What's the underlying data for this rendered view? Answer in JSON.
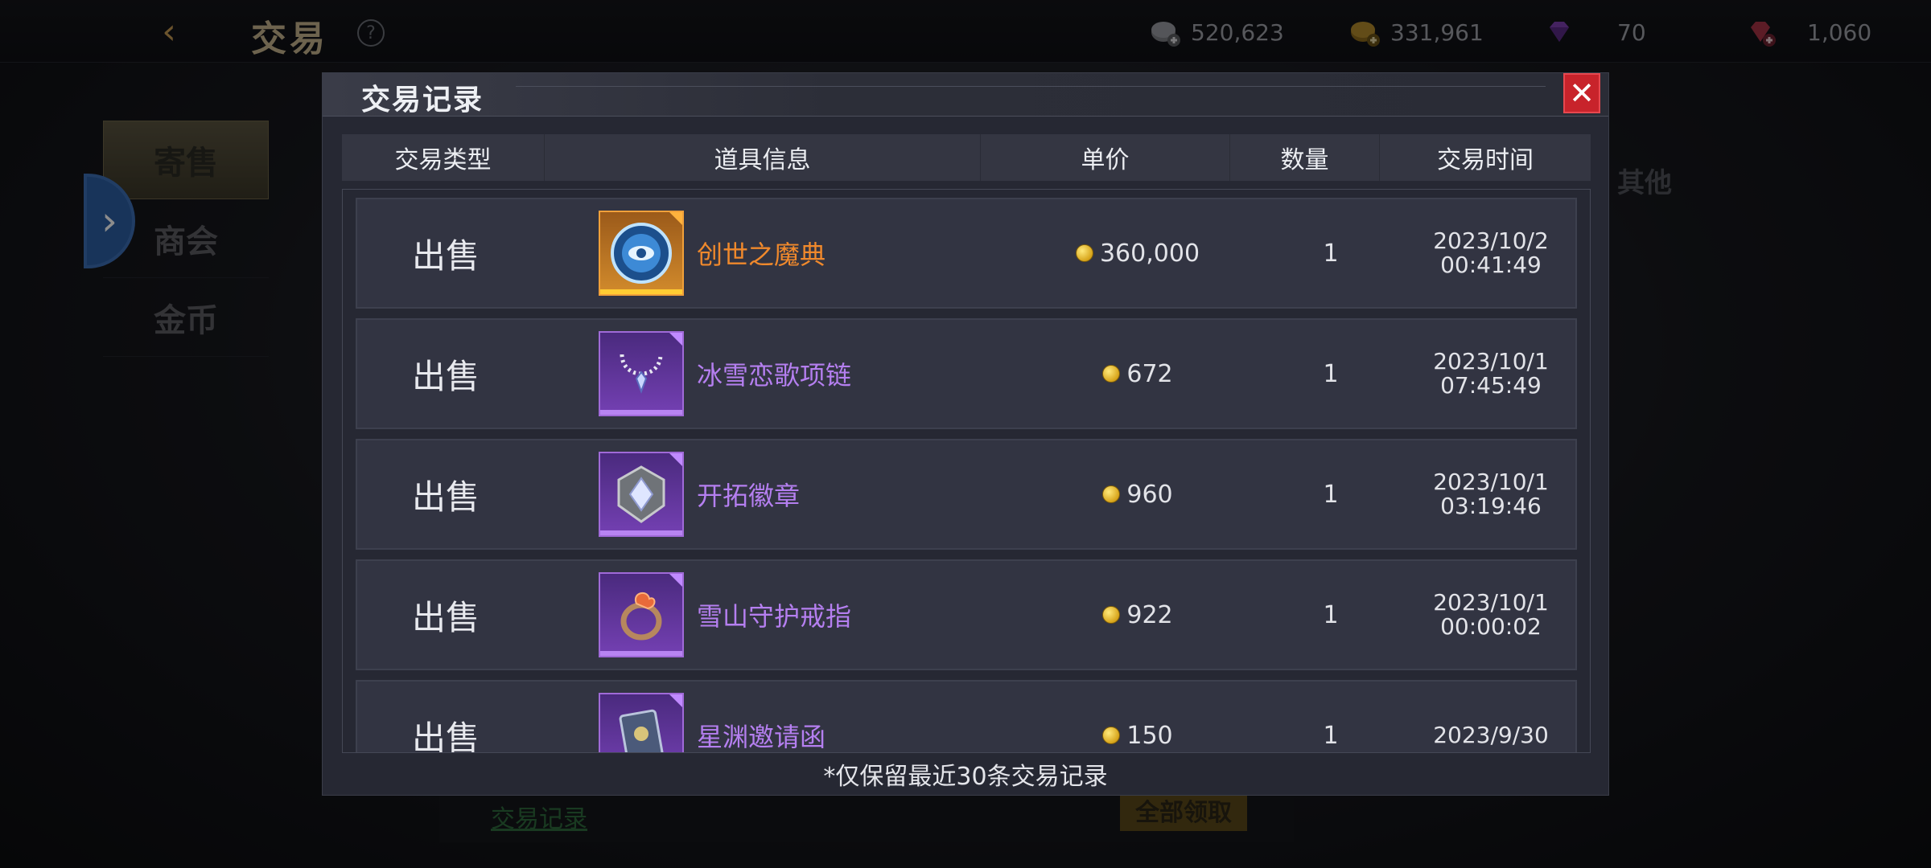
{
  "top_bar": {
    "title": "交易",
    "help": "?",
    "currencies": [
      {
        "icon": "silver-coin-add-icon",
        "value": "520,623",
        "color": "#8a8c91"
      },
      {
        "icon": "gold-coin-add-icon",
        "value": "331,961",
        "color": "#b38b2c"
      },
      {
        "icon": "purple-diamond-icon",
        "value": "70",
        "color": "#7d3fb0"
      },
      {
        "icon": "red-gem-add-icon",
        "value": "1,060",
        "color": "#a83346"
      }
    ]
  },
  "background": {
    "tabs": [
      {
        "label": "寄售",
        "active": true
      },
      {
        "label": "商会",
        "active": false
      },
      {
        "label": "金币",
        "active": false
      }
    ],
    "category_other": "其他",
    "history_link": "交易记录",
    "claim_all_button": "全部领取"
  },
  "modal": {
    "title": "交易记录",
    "close_icon": "close-icon",
    "columns": [
      "交易类型",
      "道具信息",
      "单价",
      "数量",
      "交易时间"
    ],
    "records": [
      {
        "type": "出售",
        "item_name": "创世之魔典",
        "rarity": "orange",
        "item_icon": "magic-tome-icon",
        "price": "360,000",
        "quantity": "1",
        "date": "2023/10/2",
        "time": "00:41:49"
      },
      {
        "type": "出售",
        "item_name": "冰雪恋歌项链",
        "rarity": "purple",
        "item_icon": "necklace-icon",
        "price": "672",
        "quantity": "1",
        "date": "2023/10/1",
        "time": "07:45:49"
      },
      {
        "type": "出售",
        "item_name": "开拓徽章",
        "rarity": "purple",
        "item_icon": "badge-icon",
        "price": "960",
        "quantity": "1",
        "date": "2023/10/1",
        "time": "03:19:46"
      },
      {
        "type": "出售",
        "item_name": "雪山守护戒指",
        "rarity": "purple",
        "item_icon": "ring-icon",
        "price": "922",
        "quantity": "1",
        "date": "2023/10/1",
        "time": "00:00:02"
      },
      {
        "type": "出售",
        "item_name": "星渊邀请函",
        "rarity": "purple",
        "item_icon": "invitation-icon",
        "price": "150",
        "quantity": "1",
        "date": "2023/9/30",
        "time": ""
      }
    ],
    "footnote": "*仅保留最近30条交易记录"
  },
  "colors": {
    "orange_rarity": "#f0892c",
    "purple_rarity": "#b57ff0",
    "close_red": "#c8232b",
    "panel_bg": "#262833"
  }
}
